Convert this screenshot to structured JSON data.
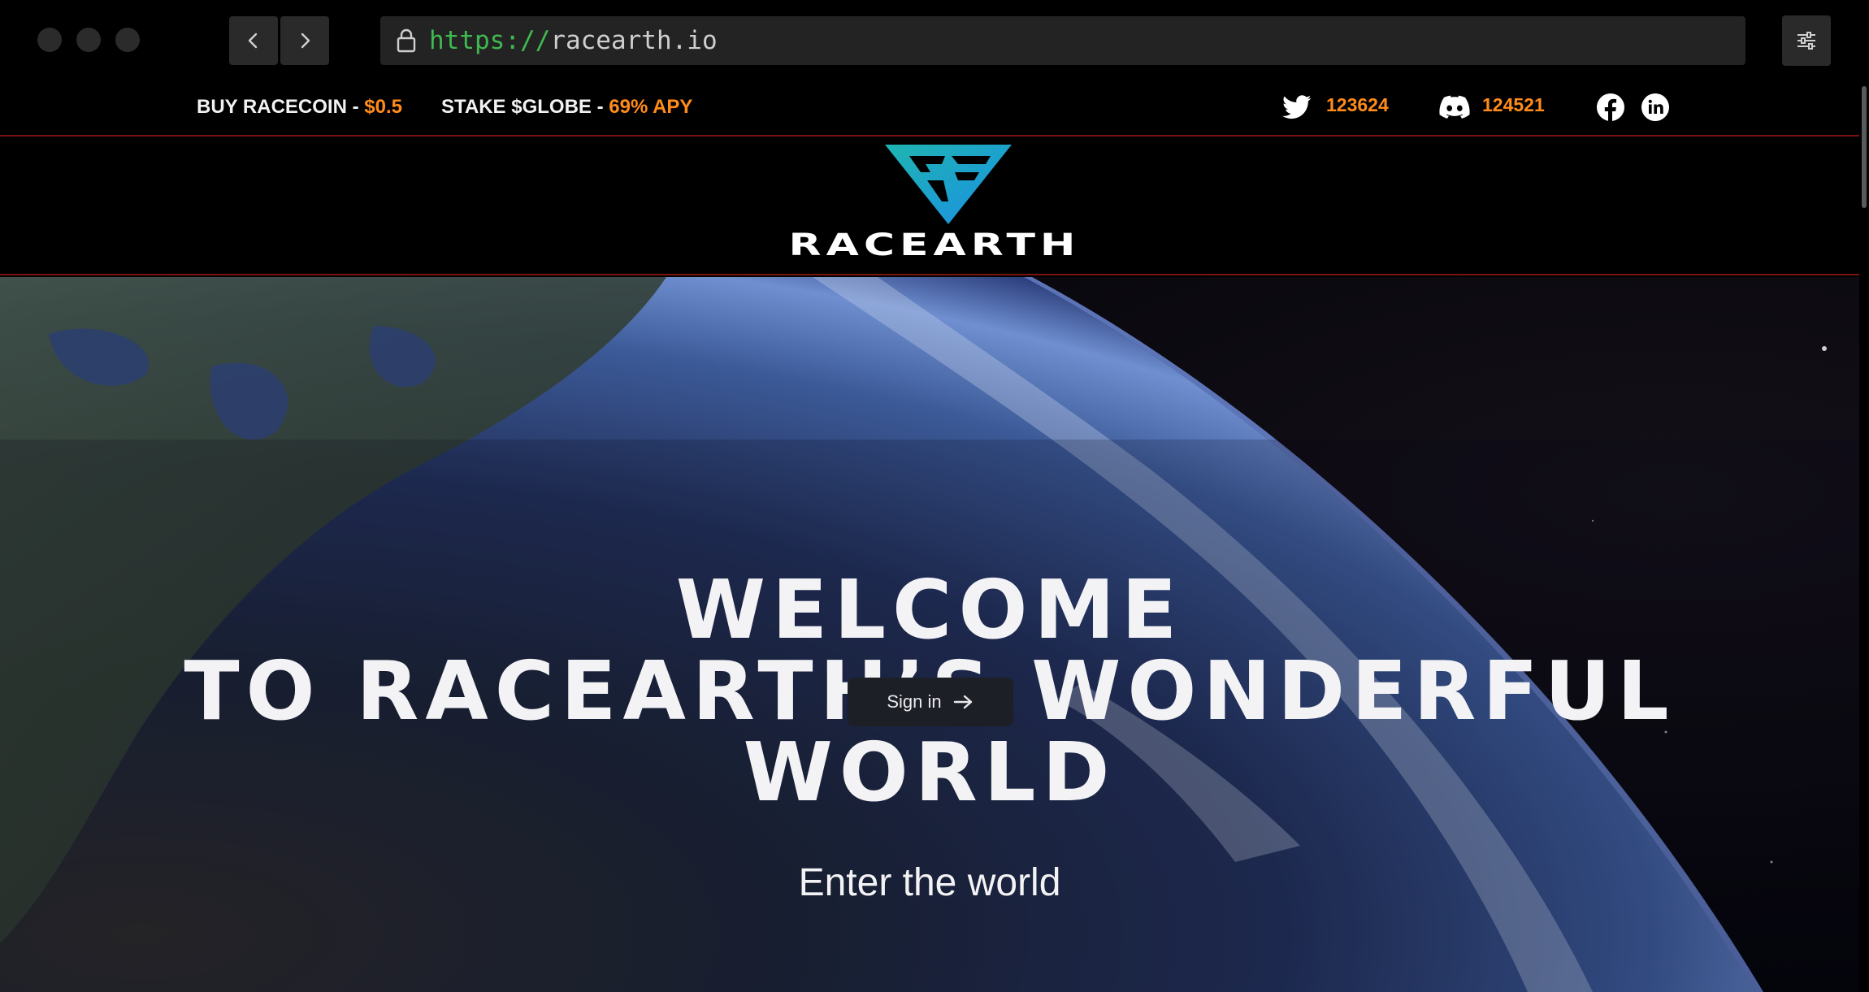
{
  "browser": {
    "url_scheme": "https://",
    "url_host": "racearth.io"
  },
  "topbar": {
    "buy_label": "BUY RACECOIN - ",
    "buy_price": "$0.5",
    "stake_label": "STAKE $GLOBE - ",
    "stake_apy": "69% APY",
    "twitter_count": "123624",
    "discord_count": "124521"
  },
  "logo": {
    "text": "RACEARTH"
  },
  "hero": {
    "title_line1": "WELCOME",
    "title_line2": "TO RACEARTH’S WONDERFUL",
    "title_line3": "WORLD",
    "subtitle": "Enter the world",
    "signin_label": "Sign in"
  },
  "colors": {
    "accent": "#ff8c1a",
    "divider": "#7a1410",
    "logo_blue": "#1aa7e6",
    "logo_teal": "#1fb5b0"
  },
  "icons": [
    "lock-icon",
    "chevron-left-icon",
    "chevron-right-icon",
    "settings-sliders-icon",
    "twitter-icon",
    "discord-icon",
    "facebook-icon",
    "linkedin-icon",
    "arrow-right-icon"
  ]
}
